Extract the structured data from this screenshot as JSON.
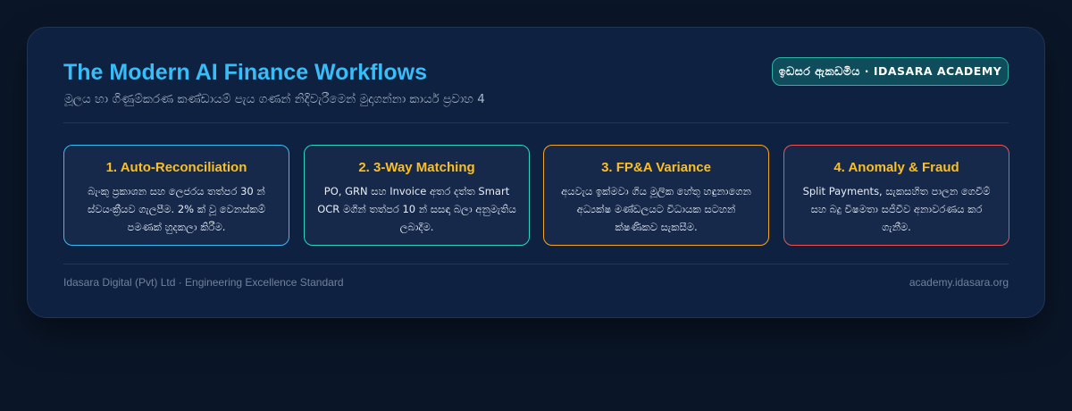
{
  "header": {
    "title": "The Modern AI Finance Workflows",
    "subtitle": "මූලය හා ගිණුම්කරණ කණ්ඩායම් පැය ගණන් නිදිවැරීමෙන් මුදාගන්නා කාර්ය ප්‍රවාහ 4",
    "badge": "ඉඩසර ඇකඩමිය · IDASARA ACADEMY"
  },
  "steps": [
    {
      "title": "1. Auto-Reconciliation",
      "description": "බැංකු ප්‍රකාශන සහ ලෙජරය තත්පර 30 න් ස්වයංක්‍රීයව ගැලපීම. 2% ක් වූ වෙනස්කම් පමණක් හුදකලා කිරීම.",
      "border_color": "#38bdf8"
    },
    {
      "title": "2. 3-Way Matching",
      "description": "PO, GRN සහ Invoice අතර දත්ත Smart OCR මගින් තත්පර 10 න් සසඳා බලා අනුමැතිය ලබාදීම.",
      "border_color": "#2dd4bf"
    },
    {
      "title": "3. FP&A Variance",
      "description": "අයවැය ඉක්මවා ගිය මූලික හේතු හඳුනාගෙන අධ්‍යක්ෂ මණ්ඩලයට විධායක සටහන් ක්ෂණිකව සැකසීම.",
      "border_color": "#f5a524"
    },
    {
      "title": "4. Anomaly & Fraud",
      "description": "Split Payments, සැකසහිත පාලන ගෙවීම් සහ බදු විෂමතා සජීවීව අනාවරණය කර ගැනීම.",
      "border_color": "#f05252"
    }
  ],
  "footer": {
    "left": "Idasara Digital (Pvt) Ltd · Engineering Excellence Standard",
    "right": "academy.idasara.org"
  }
}
